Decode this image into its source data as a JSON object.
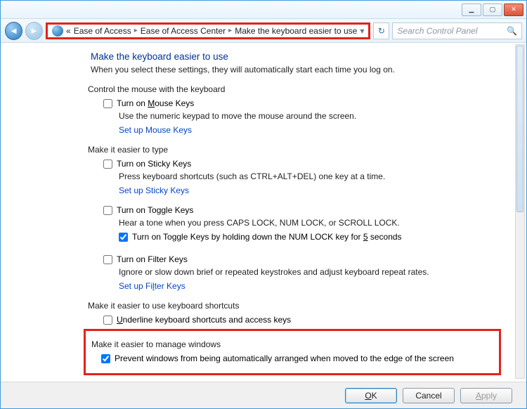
{
  "window": {
    "controls": {
      "min": "▁",
      "max": "▢",
      "close": "✕"
    }
  },
  "nav": {
    "back_glyph": "◄",
    "fwd_glyph": "►",
    "overflow": "«",
    "refresh_glyph": "↻",
    "crumbs": [
      "Ease of Access",
      "Ease of Access Center",
      "Make the keyboard easier to use"
    ],
    "search_placeholder": "Search Control Panel",
    "search_icon": "🔍"
  },
  "page": {
    "title": "Make the keyboard easier to use",
    "intro": "When you select these settings, they will automatically start each time you log on."
  },
  "groups": {
    "mouse": {
      "label": "Control the mouse with the keyboard",
      "cb_prefix": "Turn on ",
      "cb_u": "M",
      "cb_suffix": "ouse Keys",
      "desc": "Use the numeric keypad to move the mouse around the screen.",
      "link": "Set up Mouse Keys"
    },
    "type": {
      "label": "Make it easier to type",
      "sticky": {
        "cb": "Turn on Sticky Keys",
        "desc": "Press keyboard shortcuts (such as CTRL+ALT+DEL) one key at a time.",
        "link": "Set up Sticky Keys"
      },
      "toggle": {
        "cb": "Turn on Toggle Keys",
        "desc": "Hear a tone when you press CAPS LOCK, NUM LOCK, or SCROLL LOCK.",
        "hold_prefix": "Turn on Toggle Keys by holding down the NUM LOCK key for ",
        "hold_u": "5",
        "hold_suffix": " seconds"
      },
      "filter": {
        "cb": "Turn on Filter Keys",
        "desc": "Ignore or slow down brief or repeated keystrokes and adjust keyboard repeat rates.",
        "link_prefix": "Set up Fi",
        "link_u": "l",
        "link_suffix": "ter Keys"
      }
    },
    "shortcuts": {
      "label": "Make it easier to use keyboard shortcuts",
      "cb_u": "U",
      "cb_suffix": "nderline keyboard shortcuts and access keys"
    },
    "windows": {
      "label": "Make it easier to manage windows",
      "cb": "Prevent windows from being automatically arranged when moved to the edge of the screen"
    }
  },
  "buttons": {
    "ok_u": "O",
    "ok_suffix": "K",
    "cancel": "Cancel",
    "apply_u": "A",
    "apply_suffix": "pply"
  }
}
